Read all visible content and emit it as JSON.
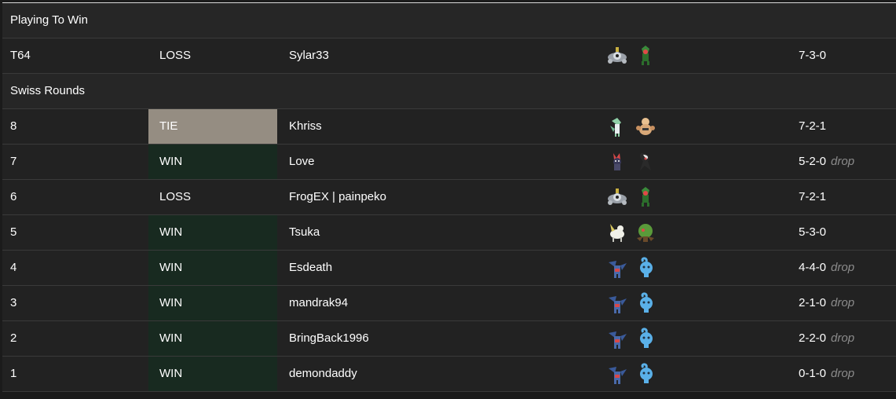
{
  "sections": {
    "playoffs_title": "Playing To Win",
    "swiss_title": "Swiss Rounds"
  },
  "rows": [
    {
      "round": "T64",
      "result": "LOSS",
      "opponent": "Sylar33",
      "record": "7-3-0",
      "drop": "",
      "team": [
        "magnezone-icon",
        "scrafty-green-icon"
      ]
    },
    {
      "round": "8",
      "result": "TIE",
      "opponent": "Khriss",
      "record": "7-2-1",
      "drop": "",
      "team": [
        "gallade-icon",
        "hariyama-icon"
      ]
    },
    {
      "round": "7",
      "result": "WIN",
      "opponent": "Love",
      "record": "5-2-0",
      "drop": "drop",
      "team": [
        "weavile-icon",
        "darkrai-icon"
      ]
    },
    {
      "round": "6",
      "result": "LOSS",
      "opponent": "FrogEX | painpeko",
      "record": "7-2-1",
      "drop": "",
      "team": [
        "magnezone-icon",
        "scrafty-green-icon"
      ]
    },
    {
      "round": "5",
      "result": "WIN",
      "opponent": "Tsuka",
      "record": "5-3-0",
      "drop": "",
      "team": [
        "arceus-icon",
        "trevenant-icon"
      ]
    },
    {
      "round": "4",
      "result": "WIN",
      "opponent": "Esdeath",
      "record": "4-4-0",
      "drop": "drop",
      "team": [
        "garchomp-icon",
        "manaphy-icon"
      ]
    },
    {
      "round": "3",
      "result": "WIN",
      "opponent": "mandrak94",
      "record": "2-1-0",
      "drop": "drop",
      "team": [
        "garchomp-icon",
        "manaphy-icon"
      ]
    },
    {
      "round": "2",
      "result": "WIN",
      "opponent": "BringBack1996",
      "record": "2-2-0",
      "drop": "drop",
      "team": [
        "garchomp-icon",
        "manaphy-icon"
      ]
    },
    {
      "round": "1",
      "result": "WIN",
      "opponent": "demondaddy",
      "record": "0-1-0",
      "drop": "drop",
      "team": [
        "garchomp-icon",
        "manaphy-icon"
      ]
    }
  ],
  "colors": {
    "page_background": "#1b1b1b",
    "row_background": "#222222",
    "win_highlight": "#182a20",
    "tie_highlight": "#958d82",
    "drop_text": "#8a8a8a"
  }
}
